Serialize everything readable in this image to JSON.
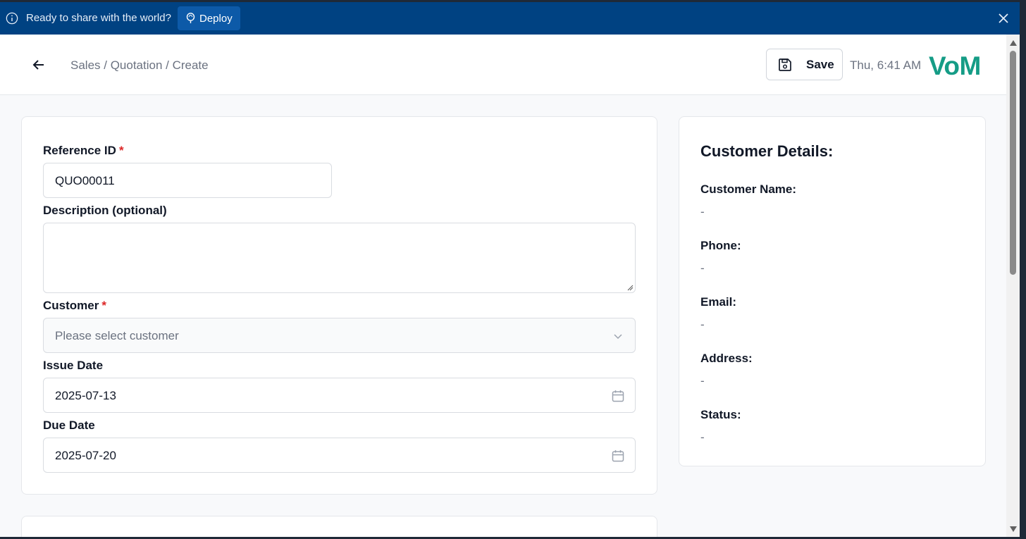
{
  "deploy_bar": {
    "message": "Ready to share with the world?",
    "deploy_label": "Deploy"
  },
  "header": {
    "breadcrumb": "Sales / Quotation / Create",
    "save_label": "Save",
    "clock": "Thu, 6:41 AM",
    "logo": "VoM"
  },
  "form": {
    "reference": {
      "label": "Reference ID",
      "required": "*",
      "value": "QUO00011"
    },
    "description": {
      "label": "Description (optional)",
      "value": ""
    },
    "customer": {
      "label": "Customer",
      "required": "*",
      "placeholder": "Please select customer"
    },
    "issue_date": {
      "label": "Issue Date",
      "value": "2025-07-13"
    },
    "due_date": {
      "label": "Due Date",
      "value": "2025-07-20"
    }
  },
  "customer_details": {
    "title": "Customer Details:",
    "fields": [
      {
        "label": "Customer Name:",
        "value": "-"
      },
      {
        "label": "Phone:",
        "value": "-"
      },
      {
        "label": "Email:",
        "value": "-"
      },
      {
        "label": "Address:",
        "value": "-"
      },
      {
        "label": "Status:",
        "value": "-"
      }
    ]
  },
  "colors": {
    "deploy_bar": "#004282",
    "deploy_button": "#0d5aa8",
    "brand": "#159c86",
    "required": "#dc2626"
  }
}
